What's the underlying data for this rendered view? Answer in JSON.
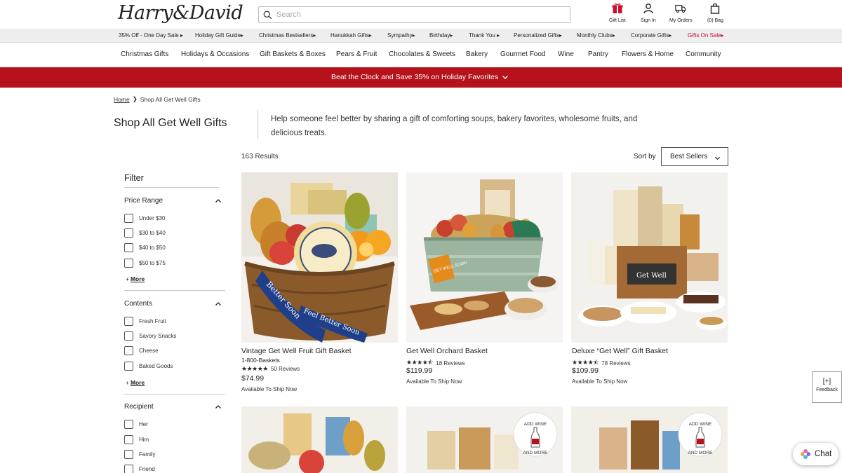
{
  "header": {
    "logo": "Harry&David",
    "search_placeholder": "Search",
    "gift_list": "Gift List",
    "sign_in": "Sign In",
    "my_orders": "My Orders",
    "bag": "(0) Bag"
  },
  "promo_links": [
    "35% Off - One Day Sale ▸",
    "Holiday Gift Guide▸",
    "Christmas Bestsellers▸",
    "Hanukkah Gifts▸",
    "Sympathy▸",
    "Birthday▸",
    "Thank You ▸",
    "Personalized Gifts▸",
    "Monthly Clubs▸",
    "Corporate Gifts▸",
    "Gifts On Sale▸"
  ],
  "main_nav": [
    "Christmas Gifts",
    "Holidays & Occasions",
    "Gift Baskets & Boxes",
    "Pears & Fruit",
    "Chocolates & Sweets",
    "Bakery",
    "Gourmet Food",
    "Wine",
    "Pantry",
    "Flowers & Home",
    "Community"
  ],
  "banner": {
    "message": "Beat the Clock and Save 35% on Holiday Favorites"
  },
  "breadcrumb": {
    "home": "Home",
    "separator": "❯",
    "current": "Shop All Get Well Gifts"
  },
  "page": {
    "title": "Shop All Get Well Gifts",
    "description": "Help someone feel better by sharing a gift of comforting soups, bakery favorites, wholesome fruits, and delicious treats.",
    "results": "163 Results",
    "sort_label": "Sort by",
    "sort_value": "Best Sellers"
  },
  "filter": {
    "title": "Filter",
    "groups": [
      {
        "title": "Price Range",
        "options": [
          "Under $30",
          "$30 to $40",
          "$40 to $50",
          "$50 to $75"
        ],
        "more": "More"
      },
      {
        "title": "Contents",
        "options": [
          "Fresh Fruit",
          "Savory Snacks",
          "Cheese",
          "Baked Goods"
        ],
        "more": "More"
      },
      {
        "title": "Recipient",
        "options": [
          "Her",
          "Him",
          "Family",
          "Friend"
        ]
      }
    ]
  },
  "products": [
    {
      "name": "Vintage Get Well Fruit Gift Basket",
      "brand": "1-800-Baskets",
      "rating": 5,
      "reviews": "50 Reviews",
      "price": "$74.99",
      "ship": "Available To Ship Now",
      "ribbon_text_1": "Better Soon",
      "ribbon_text_2": "Feel Better Soon"
    },
    {
      "name": "Get Well Orchard Basket",
      "rating": 4.5,
      "reviews": "18 Reviews",
      "price": "$119.99",
      "ship": "Available To Ship Now",
      "badge_text": "GET WELL SOON"
    },
    {
      "name": "Deluxe “Get Well” Gift Basket",
      "rating": 4.5,
      "reviews": "78 Reviews",
      "price": "$109.99",
      "ship": "Available To Ship Now",
      "sign_text": "Get Well"
    }
  ],
  "add_wine_badge": {
    "top": "ADD WINE",
    "bottom": "AND MORE"
  },
  "feedback": {
    "symbol": "[+]",
    "label": "Feedback"
  },
  "chat": {
    "label": "Chat"
  },
  "colors": {
    "banner_red": "#b5121b",
    "sale_red": "#c8102e",
    "promo_bg": "#eeeeee"
  }
}
